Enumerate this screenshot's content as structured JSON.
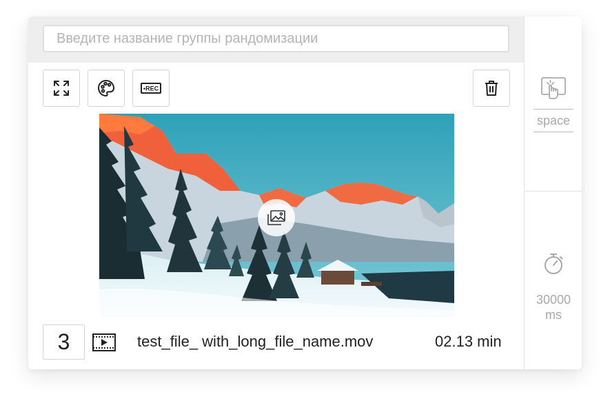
{
  "header": {
    "group_name_placeholder": "Введите название группы рандомизации",
    "group_name_value": ""
  },
  "toolbar": {
    "rec_label": "•REC"
  },
  "colors": {
    "border": "#d5d5d5",
    "header_bg": "#eeeeee",
    "muted_text": "#a9a9a9",
    "text": "#222222"
  },
  "icons": [
    "fullscreen-icon",
    "palette-icon",
    "rec-icon",
    "trash-icon",
    "image-icon",
    "video-file-icon",
    "touch-icon",
    "timer-icon"
  ],
  "item": {
    "index": "3",
    "filename": "test_file_ with_long_file_name.mov",
    "duration": "02.13 min"
  },
  "sidebar": {
    "key_label": "space",
    "timeout_value": "30000",
    "timeout_unit": "ms"
  }
}
